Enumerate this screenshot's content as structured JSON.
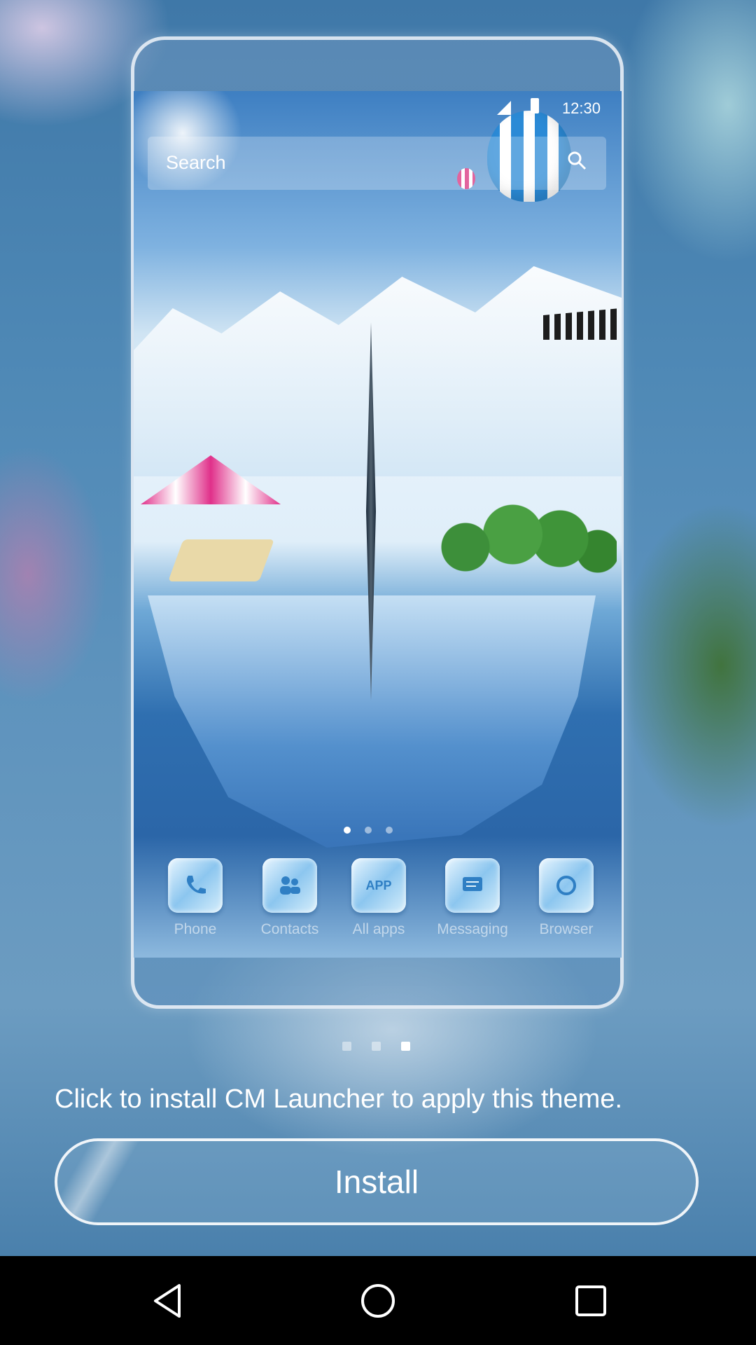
{
  "phone_preview": {
    "status_time": "12:30",
    "search_label": "Search",
    "dock": [
      {
        "label": "Phone",
        "icon": "phone-icon"
      },
      {
        "label": "Contacts",
        "icon": "contacts-icon"
      },
      {
        "label": "All apps",
        "icon": "all-apps-icon",
        "icon_text": "APP"
      },
      {
        "label": "Messaging",
        "icon": "messaging-icon"
      },
      {
        "label": "Browser",
        "icon": "browser-icon"
      }
    ]
  },
  "pager": {
    "count": 3,
    "active_index": 2
  },
  "install_prompt": "Click to install CM Launcher to apply this theme.",
  "install_button_label": "Install",
  "navbar": {
    "back": "back-icon",
    "home": "home-icon",
    "recents": "recents-icon"
  },
  "colors": {
    "accent": "#2b8ad6",
    "text": "#ffffff"
  }
}
